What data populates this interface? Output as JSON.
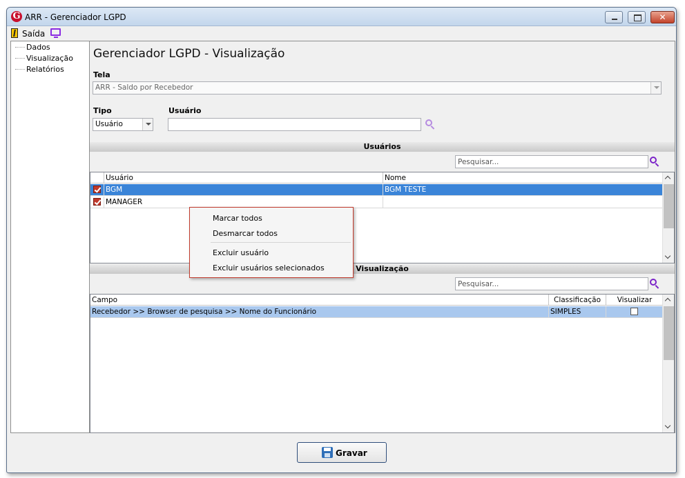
{
  "window": {
    "title": "ARR - Gerenciador LGPD",
    "logo_letter": "G",
    "close_glyph": "✕"
  },
  "toolbar": {
    "saida_label": "Saída"
  },
  "tree": {
    "items": [
      "Dados",
      "Visualização",
      "Relatórios"
    ]
  },
  "main": {
    "page_title": "Gerenciador LGPD - Visualização",
    "tela": {
      "label": "Tela",
      "value": "ARR - Saldo por Recebedor"
    },
    "tipo": {
      "label": "Tipo",
      "value": "Usuário"
    },
    "usuario": {
      "label": "Usuário",
      "value": ""
    }
  },
  "usuarios_section": {
    "header": "Usuários",
    "search_placeholder": "Pesquisar...",
    "columns": [
      "Usuário",
      "Nome"
    ],
    "rows": [
      {
        "checked": true,
        "usuario": "BGM",
        "nome": "BGM TESTE",
        "selected": true
      },
      {
        "checked": true,
        "usuario": "MANAGER",
        "nome": "",
        "selected": false
      }
    ]
  },
  "visualizacao_section": {
    "header": "Visualização",
    "search_placeholder": "Pesquisar...",
    "columns": [
      "Campo",
      "Classificação",
      "Visualizar"
    ],
    "rows": [
      {
        "campo": "Recebedor >> Browser de pesquisa >> Nome do Funcionário",
        "classificacao": "SIMPLES",
        "visualizar": false
      }
    ]
  },
  "context_menu": {
    "items": [
      "Marcar todos",
      "Desmarcar todos",
      "Excluir usuário",
      "Excluir usuários selecionados"
    ]
  },
  "footer": {
    "gravar_label": "Gravar"
  },
  "colors": {
    "selection": "#3a84d8",
    "icon_accent": "#7a22c8",
    "menu_border": "#c0392b"
  }
}
